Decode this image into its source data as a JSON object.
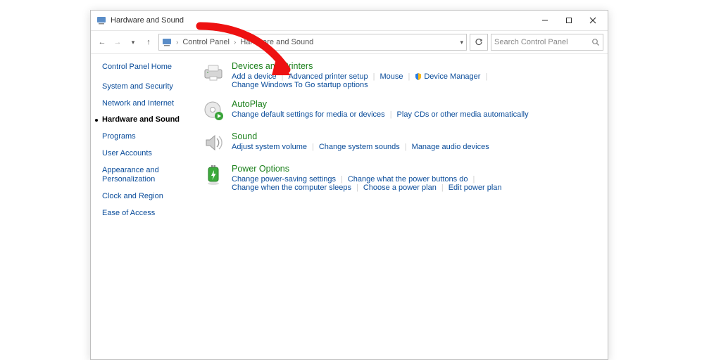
{
  "window": {
    "title": "Hardware and Sound"
  },
  "breadcrumb": {
    "root": "Control Panel",
    "current": "Hardware and Sound"
  },
  "search": {
    "placeholder": "Search Control Panel"
  },
  "sidebar": {
    "home": "Control Panel Home",
    "items": [
      "System and Security",
      "Network and Internet",
      "Hardware and Sound",
      "Programs",
      "User Accounts",
      "Appearance and Personalization",
      "Clock and Region",
      "Ease of Access"
    ],
    "current_index": 2
  },
  "categories": {
    "devices": {
      "title": "Devices and Printers",
      "links": {
        "add_device": "Add a device",
        "adv_printer": "Advanced printer setup",
        "mouse": "Mouse",
        "device_manager": "Device Manager",
        "wintogo": "Change Windows To Go startup options"
      }
    },
    "autoplay": {
      "title": "AutoPlay",
      "links": {
        "change_defaults": "Change default settings for media or devices",
        "play_cds": "Play CDs or other media automatically"
      }
    },
    "sound": {
      "title": "Sound",
      "links": {
        "adjust_volume": "Adjust system volume",
        "change_sounds": "Change system sounds",
        "manage_audio": "Manage audio devices"
      }
    },
    "power": {
      "title": "Power Options",
      "links": {
        "power_saving": "Change power-saving settings",
        "button_action": "Change what the power buttons do",
        "sleep": "Change when the computer sleeps",
        "choose_plan": "Choose a power plan",
        "edit_plan": "Edit power plan"
      }
    }
  }
}
